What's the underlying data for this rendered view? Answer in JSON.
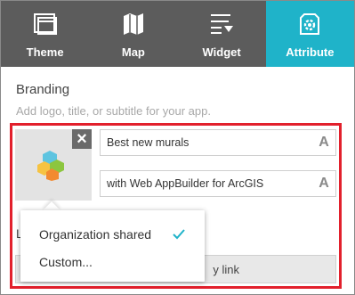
{
  "tabs": [
    {
      "label": "Theme",
      "icon": "theme-icon",
      "active": false
    },
    {
      "label": "Map",
      "icon": "map-icon",
      "active": false
    },
    {
      "label": "Widget",
      "icon": "widget-icon",
      "active": false
    },
    {
      "label": "Attribute",
      "icon": "attribute-gear-icon",
      "active": true
    }
  ],
  "branding": {
    "title": "Branding",
    "description": "Add logo, title, or subtitle for your app.",
    "title_field_value": "Best new murals",
    "subtitle_field_value": "with Web AppBuilder for ArcGIS",
    "font_button_label": "A",
    "close_label": "×",
    "link_button_label": "y link",
    "hidden_label": "L"
  },
  "dropdown": {
    "items": [
      {
        "label": "Organization shared",
        "selected": true
      },
      {
        "label": "Custom...",
        "selected": false
      }
    ]
  },
  "colors": {
    "tabbar": "#5c5c5c",
    "active_tab": "#1fb3c9",
    "highlight": "#e2202c",
    "check": "#1fb3c9"
  }
}
